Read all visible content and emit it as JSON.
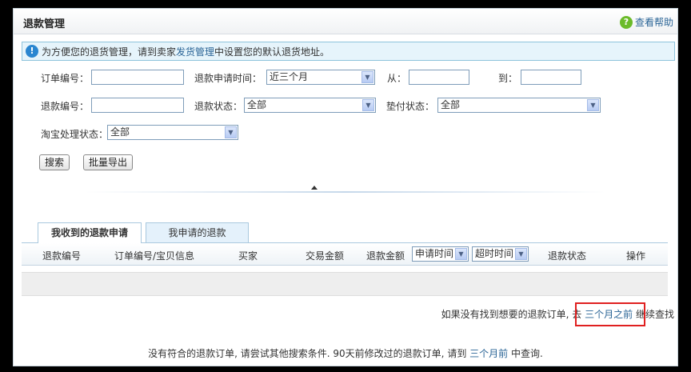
{
  "header": {
    "title": "退款管理",
    "help": "查看帮助"
  },
  "notice": {
    "prefix": "为方便您的退货管理，请到卖家",
    "link": "发货管理",
    "suffix": "中设置您的默认退货地址。"
  },
  "form": {
    "order_no_label": "订单编号：",
    "order_no_value": "",
    "apply_time_label": "退款申请时间：",
    "apply_time_value": "近三个月",
    "from_label": "从：",
    "from_value": "",
    "to_label": "到：",
    "to_value": "",
    "refund_no_label": "退款编号：",
    "refund_no_value": "",
    "refund_status_label": "退款状态：",
    "refund_status_value": "全部",
    "advance_status_label": "垫付状态：",
    "advance_status_value": "全部",
    "taobao_status_label": "淘宝处理状态：",
    "taobao_status_value": "全部",
    "search": "搜索",
    "export": "批量导出"
  },
  "tabs": [
    {
      "label": "我收到的退款申请",
      "active": true
    },
    {
      "label": "我申请的退款",
      "active": false
    }
  ],
  "table": {
    "columns": [
      "退款编号",
      "订单编号/宝贝信息",
      "买家",
      "交易金额",
      "退款金额",
      "退款状态",
      "操作"
    ],
    "apply_time_select": "申请时间",
    "timeout_select": "超时时间"
  },
  "note": {
    "prefix": "如果没有找到想要的退款订单, 去",
    "link": "三个月之前",
    "suffix": "继续查找"
  },
  "bottom": {
    "prefix": "没有符合的退款订单, 请尝试其他搜索条件. 90天前修改过的退款订单, 请到",
    "link": "三个月前",
    "suffix": "中查询."
  }
}
